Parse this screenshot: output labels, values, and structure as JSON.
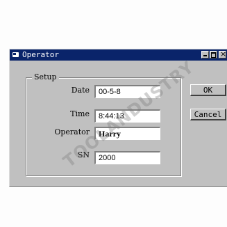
{
  "window": {
    "title": "Operator"
  },
  "setup": {
    "group_label": "Setup",
    "fields": [
      {
        "label": "Date",
        "value": "00-5-8"
      },
      {
        "label": "Time",
        "value": "8:44:13"
      },
      {
        "label": "Operator",
        "value": "Harry"
      },
      {
        "label": "SN",
        "value": "2000"
      }
    ]
  },
  "buttons": {
    "ok": "OK",
    "cancel": "Cancel"
  },
  "watermark": "TOOLANDUSTRY",
  "colors": {
    "titlebar": "#0a246a",
    "face": "#c0c0c0"
  }
}
